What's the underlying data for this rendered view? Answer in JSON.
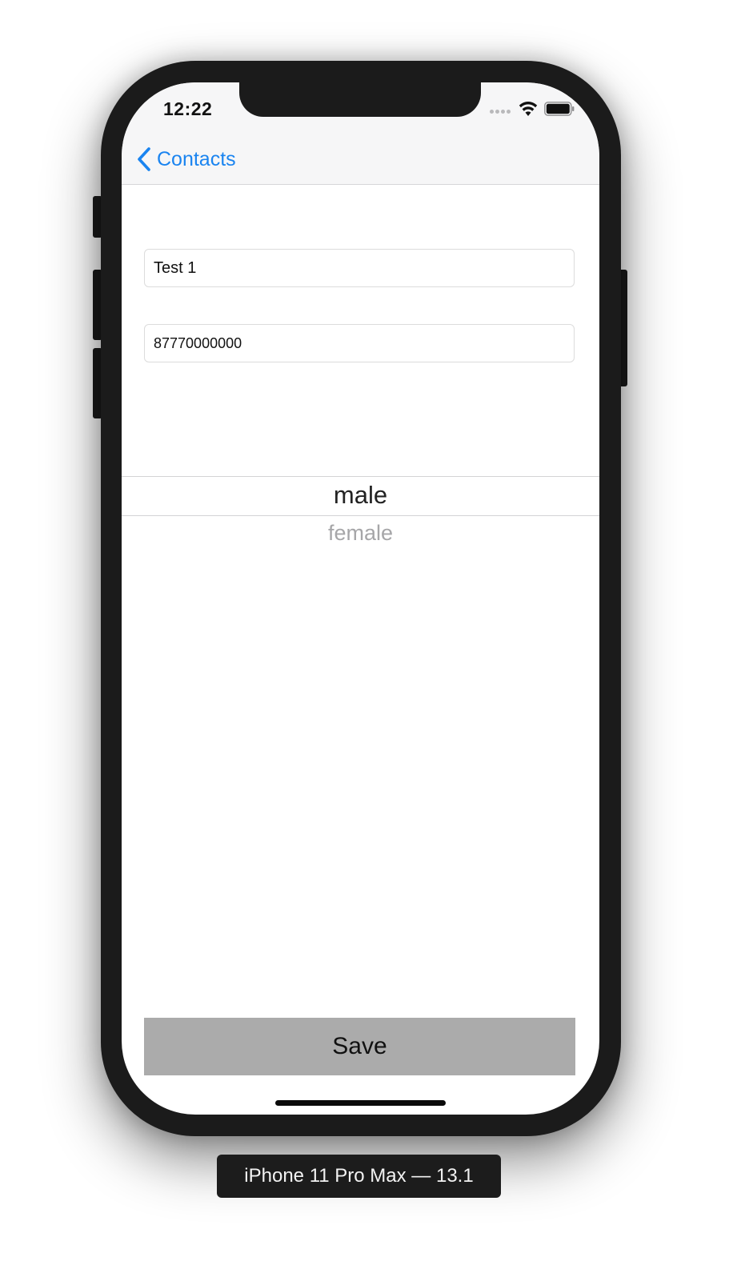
{
  "status_bar": {
    "time": "12:22"
  },
  "nav": {
    "back_label": "Contacts",
    "tint_color": "#1a84f0"
  },
  "form": {
    "name_value": "Test 1",
    "phone_value": "87770000000"
  },
  "picker": {
    "selected": "male",
    "next": "female"
  },
  "save_button": {
    "label": "Save",
    "background_color": "#ababab"
  },
  "simulator": {
    "device_label": "iPhone 11 Pro Max — 13.1"
  },
  "icons": {
    "back": "chevron-left-icon",
    "signal": "cellular-signal-icon",
    "wifi": "wifi-icon",
    "battery": "battery-icon"
  }
}
